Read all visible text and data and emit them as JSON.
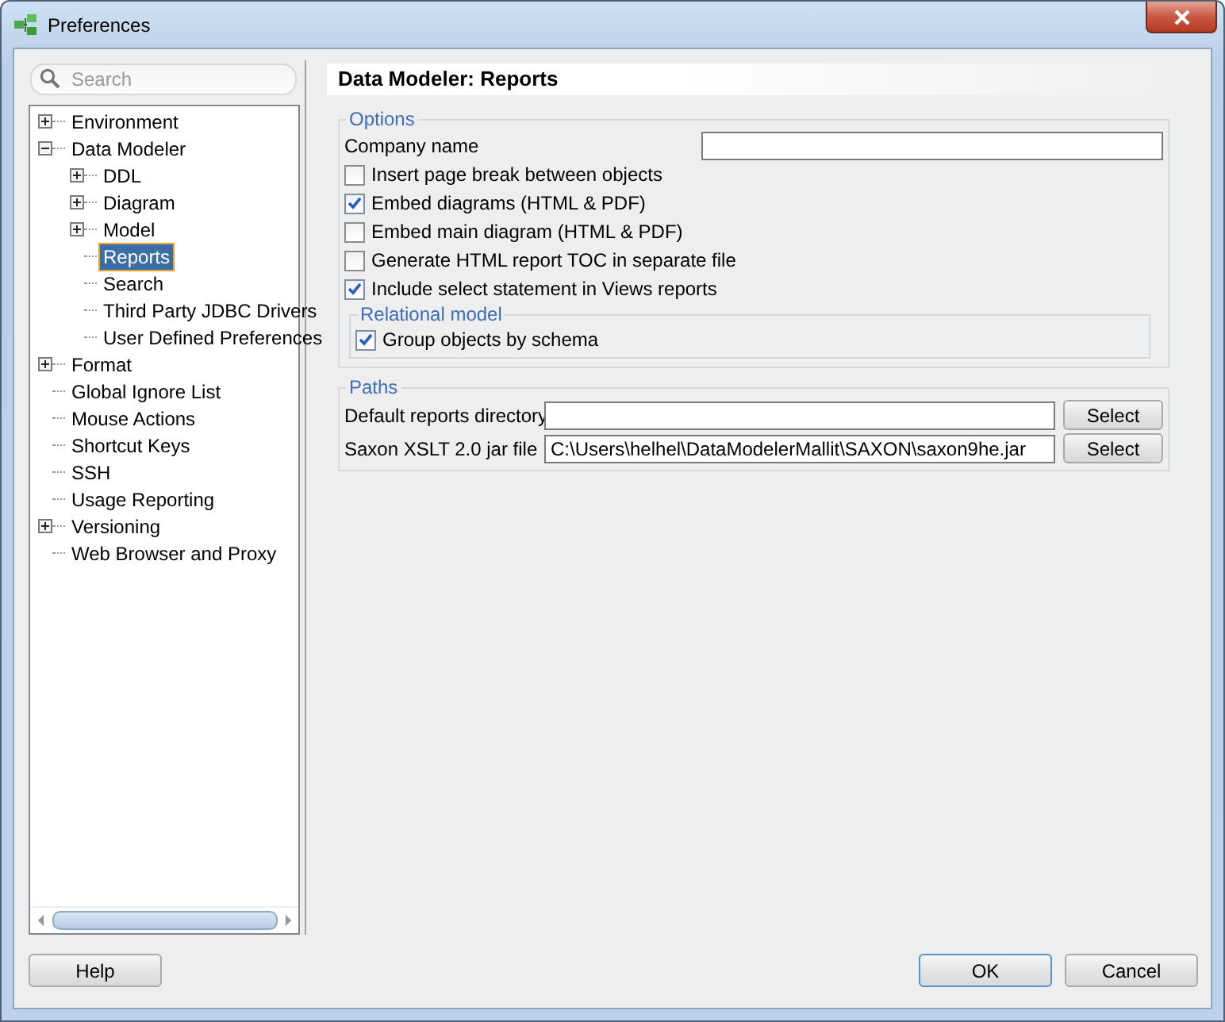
{
  "window": {
    "title": "Preferences"
  },
  "sidebar": {
    "search": {
      "placeholder": "Search"
    },
    "tree": [
      {
        "label": "Environment",
        "expanded": false,
        "selected": false
      },
      {
        "label": "Data Modeler",
        "expanded": true,
        "selected": false,
        "children": [
          {
            "label": "DDL",
            "expanded": false,
            "selected": false
          },
          {
            "label": "Diagram",
            "expanded": false,
            "selected": false
          },
          {
            "label": "Model",
            "expanded": false,
            "selected": false
          },
          {
            "label": "Reports",
            "selected": true
          },
          {
            "label": "Search",
            "selected": false
          },
          {
            "label": "Third Party JDBC Drivers",
            "selected": false
          },
          {
            "label": "User Defined Preferences",
            "selected": false
          }
        ]
      },
      {
        "label": "Format",
        "expanded": false,
        "selected": false
      },
      {
        "label": "Global Ignore List",
        "selected": false
      },
      {
        "label": "Mouse Actions",
        "selected": false
      },
      {
        "label": "Shortcut Keys",
        "selected": false
      },
      {
        "label": "SSH",
        "selected": false
      },
      {
        "label": "Usage Reporting",
        "selected": false
      },
      {
        "label": "Versioning",
        "expanded": false,
        "selected": false
      },
      {
        "label": "Web Browser and Proxy",
        "selected": false
      }
    ]
  },
  "panel": {
    "title": "Data Modeler: Reports",
    "groups": [
      {
        "legend": "Options",
        "items": [
          {
            "kind": "text",
            "label": "Company name"
          },
          {
            "kind": "checkbox",
            "label": "Insert page break between objects",
            "checked": false
          },
          {
            "kind": "checkbox",
            "label": "Embed diagrams (HTML & PDF)",
            "checked": true
          },
          {
            "kind": "checkbox",
            "label": "Embed main diagram (HTML & PDF)",
            "checked": false
          },
          {
            "kind": "checkbox",
            "label": "Generate HTML report TOC in separate file",
            "checked": false
          },
          {
            "kind": "checkbox",
            "label": "Include select statement in Views reports",
            "checked": true
          },
          {
            "kind": "group",
            "legend": "Relational model",
            "items": [
              {
                "kind": "checkbox",
                "label": "Group objects by schema",
                "checked": true
              }
            ]
          }
        ]
      },
      {
        "legend": "Paths",
        "items": [
          {
            "kind": "file",
            "label": "Default reports directory",
            "button": "Select"
          },
          {
            "kind": "file",
            "label": "Saxon XSLT 2.0 jar file",
            "value": "C:\\Users\\helhel\\DataModelerMallit\\SAXON\\saxon9he.jar",
            "button": "Select"
          }
        ]
      }
    ]
  },
  "footer": {
    "help": "Help",
    "buttons": [
      {
        "label": "OK",
        "default": true
      },
      {
        "label": "Cancel",
        "default": false
      }
    ]
  }
}
